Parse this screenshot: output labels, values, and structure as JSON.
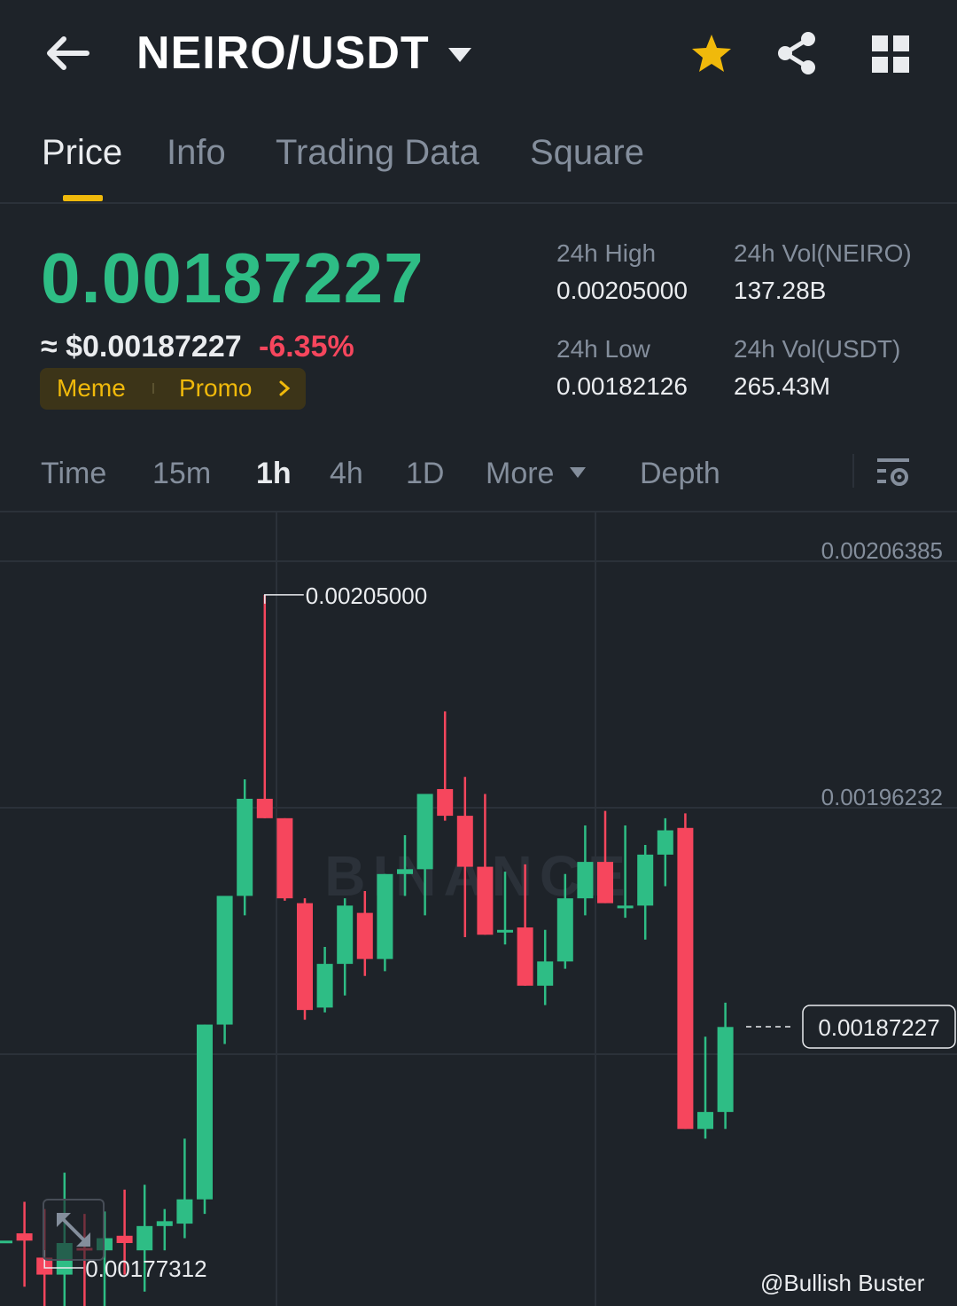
{
  "header": {
    "pair": "NEIRO/USDT",
    "star_color": "#f0b90b"
  },
  "tabs": [
    {
      "label": "Price",
      "active": true
    },
    {
      "label": "Info",
      "active": false
    },
    {
      "label": "Trading Data",
      "active": false
    },
    {
      "label": "Square",
      "active": false
    }
  ],
  "price": {
    "last": "0.00187227",
    "approx": "≈ $0.00187227",
    "change_pct": "-6.35%",
    "up_color": "#2ebd85",
    "down_color": "#f6465d"
  },
  "tags": {
    "meme": "Meme",
    "promo": "Promo"
  },
  "stats": {
    "high_label": "24h High",
    "high_value": "0.00205000",
    "low_label": "24h Low",
    "low_value": "0.00182126",
    "vol_base_label": "24h Vol(NEIRO)",
    "vol_base_value": "137.28B",
    "vol_quote_label": "24h Vol(USDT)",
    "vol_quote_value": "265.43M"
  },
  "intervals": [
    {
      "label": "Time",
      "active": false
    },
    {
      "label": "15m",
      "active": false
    },
    {
      "label": "1h",
      "active": true
    },
    {
      "label": "4h",
      "active": false
    },
    {
      "label": "1D",
      "active": false
    },
    {
      "label": "More",
      "active": false
    },
    {
      "label": "Depth",
      "active": false
    }
  ],
  "chart_data": {
    "type": "candlestick",
    "y_axis_labels": [
      "0.00206385",
      "0.00196232"
    ],
    "current_price_label": "0.00187227",
    "high_marker": "0.00205000",
    "low_marker": "0.00177312",
    "ylim": [
      0.0017,
      0.00208
    ],
    "watermark": "BINANCE",
    "candles": [
      {
        "o": 0.001784,
        "h": 0.001784,
        "l": 0.001784,
        "c": 0.001784
      },
      {
        "o": 0.001787,
        "h": 0.0018,
        "l": 0.001765,
        "c": 0.001784
      },
      {
        "o": 0.001777,
        "h": 0.001797,
        "l": 0.001745,
        "c": 0.00177
      },
      {
        "o": 0.00177,
        "h": 0.001812,
        "l": 0.001755,
        "c": 0.001783
      },
      {
        "o": 0.001781,
        "h": 0.001795,
        "l": 0.001745,
        "c": 0.00178
      },
      {
        "o": 0.00178,
        "h": 0.001796,
        "l": 0.001742,
        "c": 0.001785
      },
      {
        "o": 0.001786,
        "h": 0.001805,
        "l": 0.00177,
        "c": 0.001783
      },
      {
        "o": 0.00178,
        "h": 0.001807,
        "l": 0.001763,
        "c": 0.00179
      },
      {
        "o": 0.00179,
        "h": 0.001797,
        "l": 0.00178,
        "c": 0.001792
      },
      {
        "o": 0.001791,
        "h": 0.001826,
        "l": 0.001785,
        "c": 0.001801
      },
      {
        "o": 0.001801,
        "h": 0.001823,
        "l": 0.001795,
        "c": 0.001873
      },
      {
        "o": 0.001873,
        "h": 0.001904,
        "l": 0.001865,
        "c": 0.001926
      },
      {
        "o": 0.001926,
        "h": 0.001974,
        "l": 0.001918,
        "c": 0.001966
      },
      {
        "o": 0.001966,
        "h": 0.00205,
        "l": 0.001963,
        "c": 0.001958
      },
      {
        "o": 0.001958,
        "h": 0.001925,
        "l": 0.001924,
        "c": 0.001925
      },
      {
        "o": 0.001923,
        "h": 0.001925,
        "l": 0.001875,
        "c": 0.001879
      },
      {
        "o": 0.00188,
        "h": 0.001905,
        "l": 0.001878,
        "c": 0.001898
      },
      {
        "o": 0.001898,
        "h": 0.001925,
        "l": 0.001885,
        "c": 0.001922
      },
      {
        "o": 0.001919,
        "h": 0.001928,
        "l": 0.001893,
        "c": 0.0019
      },
      {
        "o": 0.0019,
        "h": 0.001935,
        "l": 0.001895,
        "c": 0.001935
      },
      {
        "o": 0.001935,
        "h": 0.001951,
        "l": 0.001926,
        "c": 0.001937
      },
      {
        "o": 0.001937,
        "h": 0.001956,
        "l": 0.001918,
        "c": 0.001968
      },
      {
        "o": 0.00197,
        "h": 0.002002,
        "l": 0.001957,
        "c": 0.001959
      },
      {
        "o": 0.001959,
        "h": 0.001975,
        "l": 0.001909,
        "c": 0.001938
      },
      {
        "o": 0.001938,
        "h": 0.001968,
        "l": 0.001916,
        "c": 0.00191
      },
      {
        "o": 0.001911,
        "h": 0.001936,
        "l": 0.001906,
        "c": 0.001912
      },
      {
        "o": 0.001913,
        "h": 0.001939,
        "l": 0.001898,
        "c": 0.001889
      },
      {
        "o": 0.001889,
        "h": 0.001912,
        "l": 0.001881,
        "c": 0.001899
      },
      {
        "o": 0.001899,
        "h": 0.001935,
        "l": 0.001896,
        "c": 0.001925
      },
      {
        "o": 0.001925,
        "h": 0.001955,
        "l": 0.001918,
        "c": 0.00194
      },
      {
        "o": 0.00194,
        "h": 0.001961,
        "l": 0.001926,
        "c": 0.001923
      },
      {
        "o": 0.001922,
        "h": 0.001955,
        "l": 0.001917,
        "c": 0.001922
      },
      {
        "o": 0.001922,
        "h": 0.001947,
        "l": 0.001908,
        "c": 0.001943
      },
      {
        "o": 0.001943,
        "h": 0.001958,
        "l": 0.00193,
        "c": 0.001953
      },
      {
        "o": 0.001954,
        "h": 0.00196,
        "l": 0.001865,
        "c": 0.00183
      },
      {
        "o": 0.00183,
        "h": 0.001868,
        "l": 0.001826,
        "c": 0.001837
      },
      {
        "o": 0.001837,
        "h": 0.001882,
        "l": 0.00183,
        "c": 0.001872
      }
    ]
  },
  "watermark_text": "@Bullish Buster"
}
